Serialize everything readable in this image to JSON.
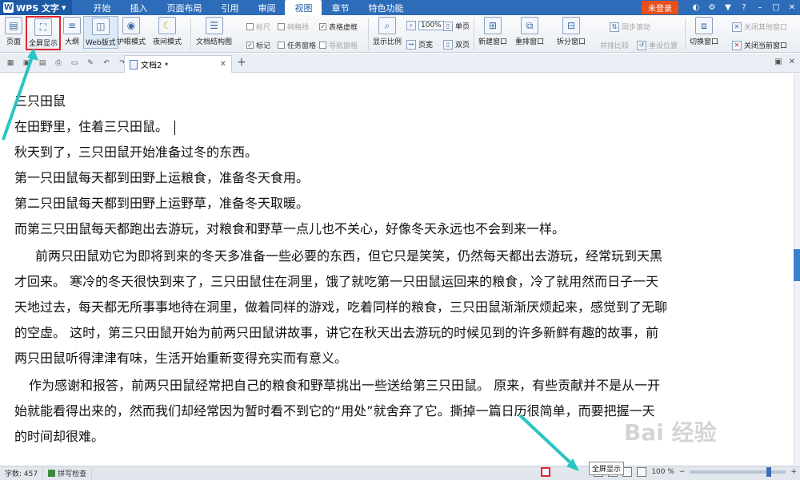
{
  "titlebar": {
    "app_name": "WPS 文字",
    "menu": [
      "开始",
      "插入",
      "页面布局",
      "引用",
      "审阅",
      "视图",
      "章节",
      "特色功能"
    ],
    "active_menu_index": 5,
    "login_label": "未登录"
  },
  "ribbon": {
    "buttons": {
      "page": "页面",
      "fullscreen": "全屏显示",
      "outline": "大纲",
      "web": "Web版式",
      "eye": "护眼模式",
      "night": "夜间模式",
      "docmap": "文档结构图",
      "zoom": "显示比例",
      "newwin": "新建窗口",
      "arrange": "重排窗口",
      "split": "拆分窗口",
      "switchwin": "切换窗口"
    },
    "checks": {
      "ruler": "标尺",
      "grid": "网格线",
      "table_grid": "表格虚框",
      "mark": "标记",
      "taskpane": "任务窗格",
      "navpane": "导航窗格"
    },
    "zoom_pct": "100%",
    "single_page": "单页",
    "page_width": "页宽",
    "two_pages": "双页",
    "sync_scroll": "同步滚动",
    "side_by_side": "并排比较",
    "reset_pos": "重设位置",
    "close_other": "关闭其他窗口",
    "close_current": "关闭当前窗口"
  },
  "tabbar": {
    "doc_tab": "文档2 *"
  },
  "document": {
    "lines": [
      "三只田鼠",
      "在田野里，住着三只田鼠。",
      "秋天到了，三只田鼠开始准备过冬的东西。",
      "第一只田鼠每天都到田野上运粮食，准备冬天食用。",
      "第二只田鼠每天都到田野上运野草，准备冬天取暖。",
      "而第三只田鼠每天都跑出去游玩，对粮食和野草一点儿也不关心，好像冬天永远也不会到来一样。",
      "前两只田鼠劝它为即将到来的冬天多准备一些必要的东西，但它只是笑笑，仍然每天都出去游玩，经常玩到天黑",
      "才回来。  寒冷的冬天很快到来了，三只田鼠住在洞里，饿了就吃第一只田鼠运回来的粮食，冷了就用然而日子一天",
      "天地过去，每天都无所事事地待在洞里，做着同样的游戏，吃着同样的粮食，三只田鼠渐渐厌烦起来，感觉到了无聊",
      "的空虚。  这时，第三只田鼠开始为前两只田鼠讲故事，讲它在秋天出去游玩的时候见到的许多新鲜有趣的故事，前",
      "两只田鼠听得津津有味，生活开始重新变得充实而有意义。",
      "作为感谢和报答，前两只田鼠经常把自己的粮食和野草挑出一些送给第三只田鼠。  原来，有些贡献并不是从一开",
      "始就能看得出来的，然而我们却经常因为暂时看不到它的“用处”就舍弃了它。撕掉一篇日历很简单，而要把握一天",
      "的时间却很难。"
    ]
  },
  "statusbar": {
    "word_count_label": "字数: 457",
    "spell_check": "拼写检查",
    "zoom_text": "100 %",
    "tooltip": "全屏显示"
  },
  "watermark": "Bai 经验"
}
